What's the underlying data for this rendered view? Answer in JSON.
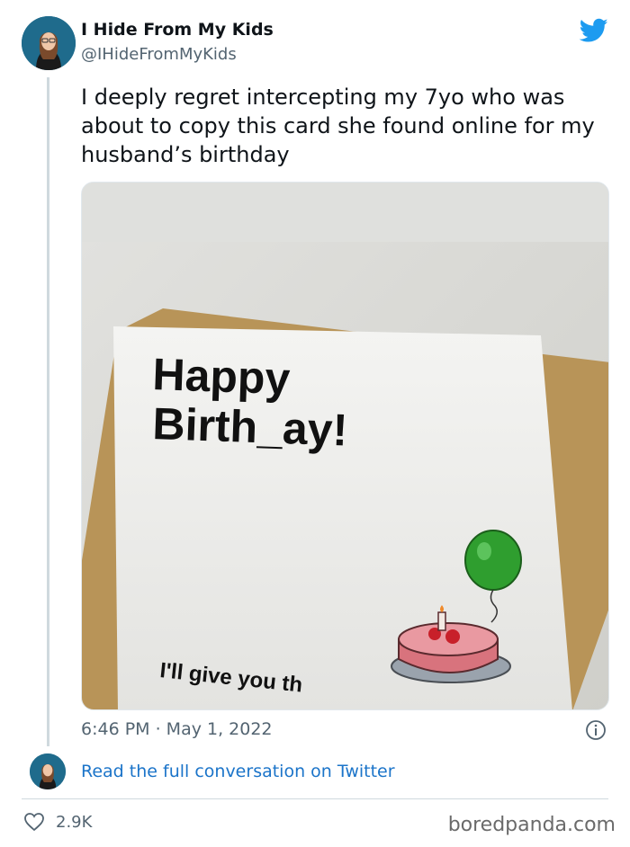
{
  "author": {
    "name": "I Hide From My Kids",
    "handle": "@IHideFromMyKids"
  },
  "tweet": {
    "text": "I deeply regret intercepting my 7yo who was about to copy this card she found online for my husband’s birthday",
    "timestamp": "6:46 PM · May 1, 2022",
    "likes": "2.9K"
  },
  "card_image": {
    "line1": "Happy",
    "line2": "Birth_ay!",
    "footer": "I'll give you th"
  },
  "links": {
    "read_full": "Read the full conversation on Twitter"
  },
  "watermark": "boredpanda.com",
  "colors": {
    "twitter_blue": "#1d9bf0",
    "link_blue": "#1b74c9",
    "secondary_text": "#536471"
  },
  "icons": [
    "twitter-bird-icon",
    "info-icon",
    "heart-icon"
  ]
}
